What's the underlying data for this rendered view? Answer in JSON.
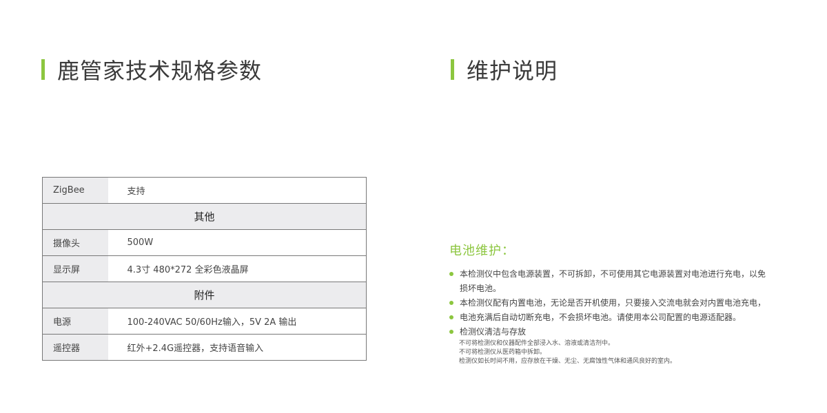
{
  "left_heading": "鹿管家技术规格参数",
  "right_heading": "维护说明",
  "spec_table": {
    "rows": [
      {
        "type": "kv",
        "key": "ZigBee",
        "value": "支持"
      },
      {
        "type": "section",
        "label": "其他"
      },
      {
        "type": "kv",
        "key": "摄像头",
        "value": "500W"
      },
      {
        "type": "kv",
        "key": "显示屏",
        "value": "4.3寸 480*272 全彩色液晶屏"
      },
      {
        "type": "section",
        "label": "附件"
      },
      {
        "type": "kv",
        "key": "电源",
        "value": "100-240VAC 50/60Hz输入，5V 2A 输出"
      },
      {
        "type": "kv",
        "key": "遥控器",
        "value": "红外+2.4G遥控器，支持语音输入"
      }
    ]
  },
  "maintenance": {
    "subtitle": "电池维护：",
    "items": [
      {
        "text": "本检测仪中包含电源装置，不可拆卸，不可使用其它电源装置对电池进行充电，以免损坏电池。"
      },
      {
        "text": "本检测仪配有内置电池，无论是否开机使用，只要接入交流电就会对内置电池充电，"
      },
      {
        "text": "电池充满后自动切断充电，不会损坏电池。请使用本公司配置的电源适配器。"
      },
      {
        "text": "检测仪清洁与存放"
      }
    ],
    "sub_items": [
      "不可将检测仪和仪器配件全部浸入水、溶液或清洁剂中。",
      "不可将检测仪从医药箱中拆卸。",
      "检测仪如长时间不用，应存放在干燥、无尘、无腐蚀性气体和通风良好的室内。"
    ]
  },
  "colors": {
    "accent": "#8cc63f",
    "table_shade": "#ececee"
  }
}
